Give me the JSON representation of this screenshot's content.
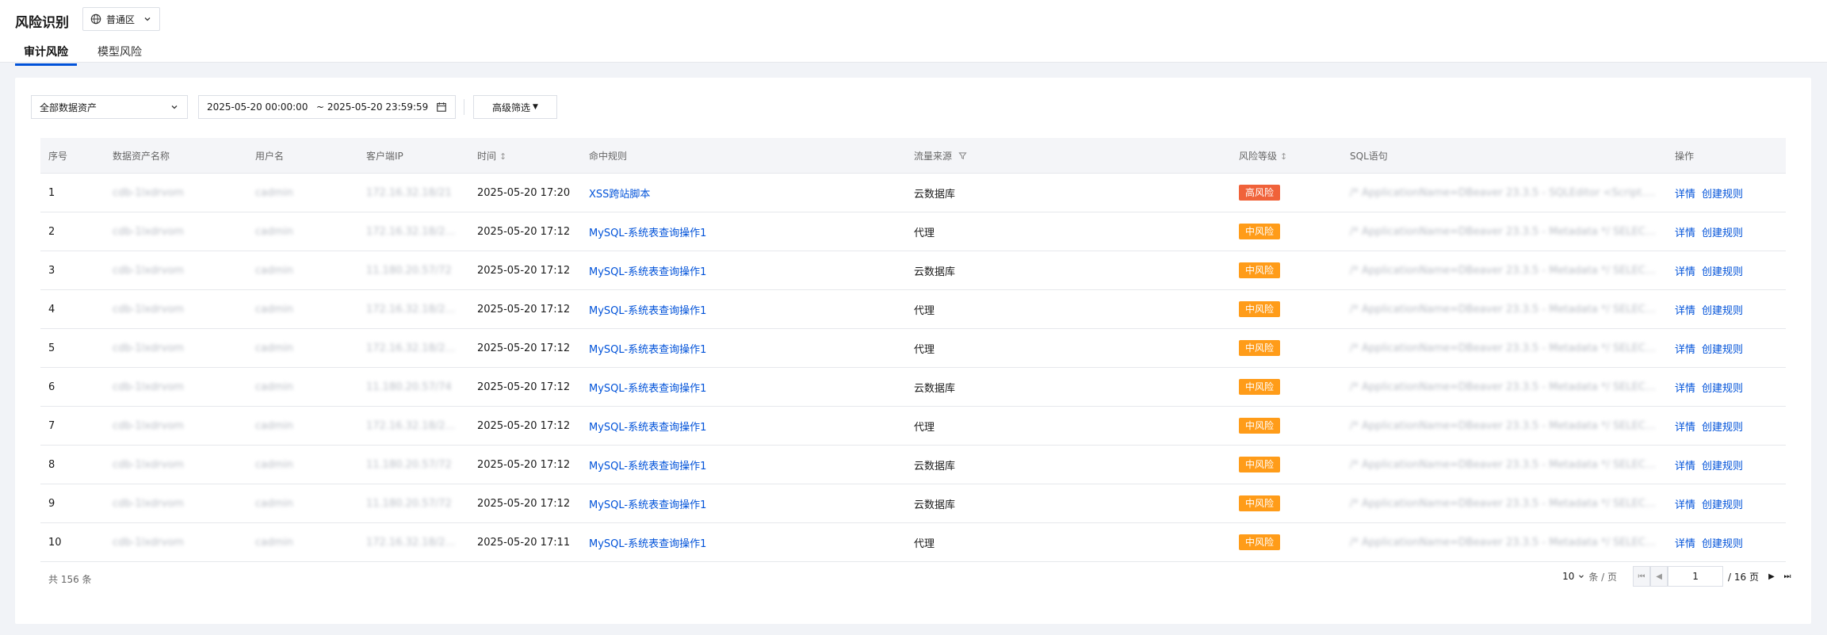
{
  "header": {
    "title": "风险识别",
    "region": "普通区",
    "tabs": [
      {
        "label": "审计风险",
        "active": true
      },
      {
        "label": "模型风险",
        "active": false
      }
    ]
  },
  "filters": {
    "asset_select": "全部数据资产",
    "date_start": "2025-05-20 00:00:00",
    "date_end": "~ 2025-05-20 23:59:59",
    "advanced": "高级筛选"
  },
  "table": {
    "columns": [
      "序号",
      "数据资产名称",
      "用户名",
      "客户端IP",
      "时间",
      "命中规则",
      "流量来源",
      "风险等级",
      "SQL语句",
      "操作"
    ],
    "rows": [
      {
        "idx": "1",
        "asset": "cdb-1lxdrvom",
        "user": "cadmin",
        "ip": "172.16.32.18/21",
        "time": "2025-05-20 17:20",
        "rule": "XSS跨站脚本",
        "source": "云数据库",
        "level": "高风险",
        "sql": "/* ApplicationName=DBeaver 23.3.5 - SQLEditor <Script.sql> */ S..."
      },
      {
        "idx": "2",
        "asset": "cdb-1lxdrvom",
        "user": "cadmin",
        "ip": "172.16.32.18/27909",
        "time": "2025-05-20 17:12",
        "rule": "MySQL-系统表查询操作1",
        "source": "代理",
        "level": "中风险",
        "sql": "/* ApplicationName=DBeaver 23.3.5 - Metadata */ SELECT ta.CO..."
      },
      {
        "idx": "3",
        "asset": "cdb-1lxdrvom",
        "user": "cadmin",
        "ip": "11.180.20.57/72",
        "time": "2025-05-20 17:12",
        "rule": "MySQL-系统表查询操作1",
        "source": "云数据库",
        "level": "中风险",
        "sql": "/* ApplicationName=DBeaver 23.3.5 - Metadata */ SELECT * FRO..."
      },
      {
        "idx": "4",
        "asset": "cdb-1lxdrvom",
        "user": "cadmin",
        "ip": "172.16.32.18/27909",
        "time": "2025-05-20 17:12",
        "rule": "MySQL-系统表查询操作1",
        "source": "代理",
        "level": "中风险",
        "sql": "/* ApplicationName=DBeaver 23.3.5 - Metadata */ SELECT * FRO..."
      },
      {
        "idx": "5",
        "asset": "cdb-1lxdrvom",
        "user": "cadmin",
        "ip": "172.16.32.18/27909",
        "time": "2025-05-20 17:12",
        "rule": "MySQL-系统表查询操作1",
        "source": "代理",
        "level": "中风险",
        "sql": "/* ApplicationName=DBeaver 23.3.5 - Metadata */ SELECT * FRO..."
      },
      {
        "idx": "6",
        "asset": "cdb-1lxdrvom",
        "user": "cadmin",
        "ip": "11.180.20.57/74",
        "time": "2025-05-20 17:12",
        "rule": "MySQL-系统表查询操作1",
        "source": "云数据库",
        "level": "中风险",
        "sql": "/* ApplicationName=DBeaver 23.3.5 - Metadata */ SELECT * FRO..."
      },
      {
        "idx": "7",
        "asset": "cdb-1lxdrvom",
        "user": "cadmin",
        "ip": "172.16.32.18/27909",
        "time": "2025-05-20 17:12",
        "rule": "MySQL-系统表查询操作1",
        "source": "代理",
        "level": "中风险",
        "sql": "/* ApplicationName=DBeaver 23.3.5 - Metadata */ SELECT * FRO..."
      },
      {
        "idx": "8",
        "asset": "cdb-1lxdrvom",
        "user": "cadmin",
        "ip": "11.180.20.57/72",
        "time": "2025-05-20 17:12",
        "rule": "MySQL-系统表查询操作1",
        "source": "云数据库",
        "level": "中风险",
        "sql": "/* ApplicationName=DBeaver 23.3.5 - Metadata */ SELECT * FRO..."
      },
      {
        "idx": "9",
        "asset": "cdb-1lxdrvom",
        "user": "cadmin",
        "ip": "11.180.20.57/72",
        "time": "2025-05-20 17:12",
        "rule": "MySQL-系统表查询操作1",
        "source": "云数据库",
        "level": "中风险",
        "sql": "/* ApplicationName=DBeaver 23.3.5 - Metadata */ SELECT ta.CO..."
      },
      {
        "idx": "10",
        "asset": "cdb-1lxdrvom",
        "user": "cadmin",
        "ip": "172.16.32.18/27909",
        "time": "2025-05-20 17:11",
        "rule": "MySQL-系统表查询操作1",
        "source": "代理",
        "level": "中风险",
        "sql": "/* ApplicationName=DBeaver 23.3.5 - Metadata */ SELECT * FRO..."
      }
    ],
    "ops": {
      "detail": "详情",
      "create_rule": "创建规则"
    }
  },
  "level_colors": {
    "高风险": "#f0623a",
    "中风险": "#ff9c19"
  },
  "footer": {
    "total": "共 156 条",
    "page_size": "10",
    "page_size_unit": "条 / 页",
    "current_page": "1",
    "total_pages": "/ 16 页"
  }
}
